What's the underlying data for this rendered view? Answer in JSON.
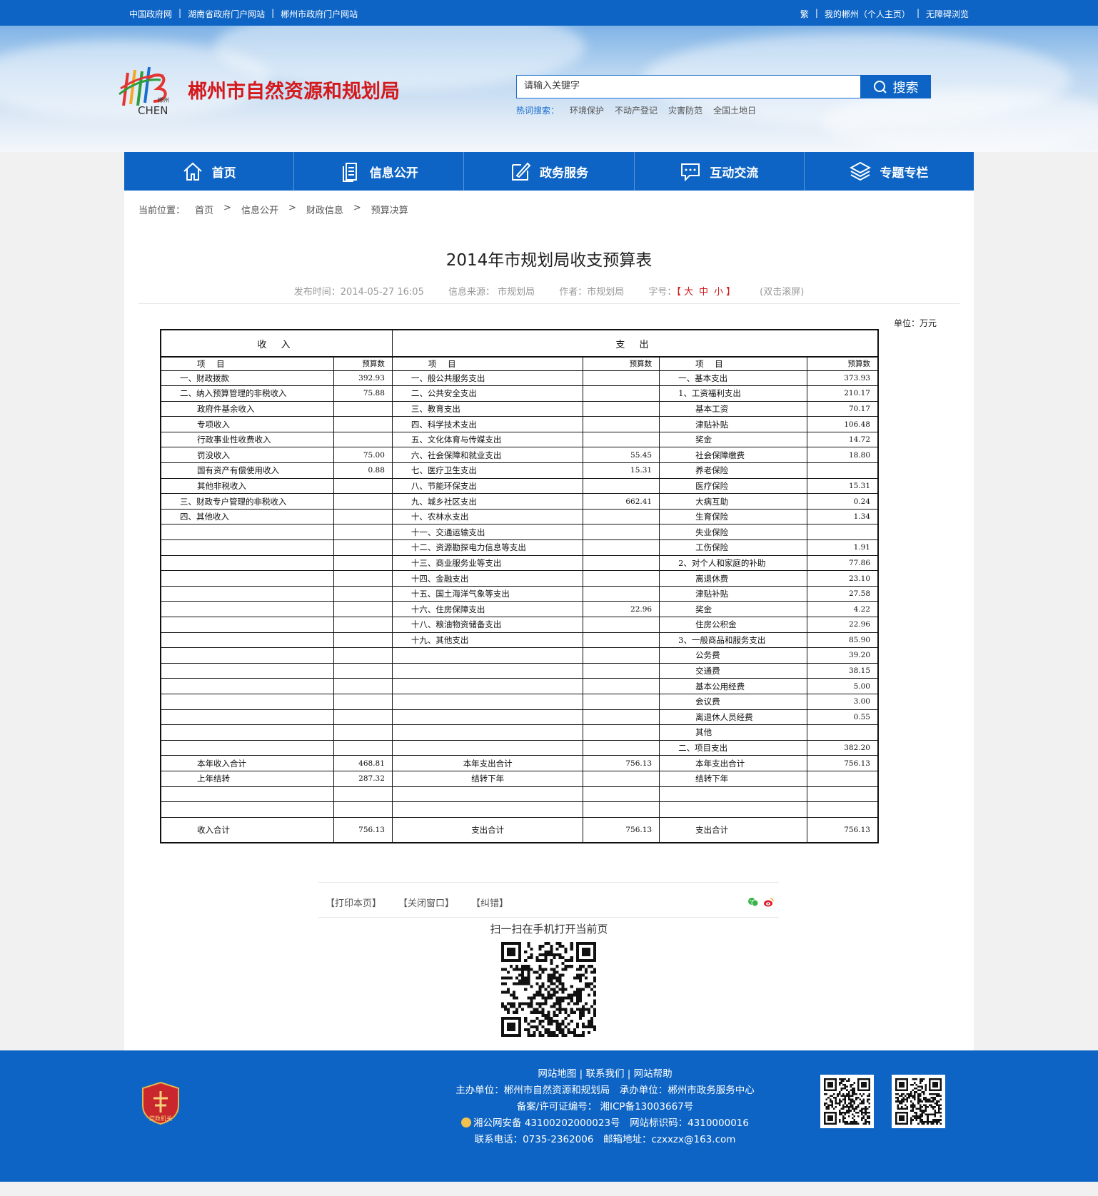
{
  "topbar": {
    "left_links": [
      "中国政府网",
      "湖南省政府门户网站",
      "郴州市政府门户网站"
    ],
    "right_links": [
      "繁",
      "我的郴州（个人主页）",
      "无障碍浏览"
    ]
  },
  "header": {
    "site_name": "郴州市自然资源和规划局",
    "logo_text": "CHEN",
    "logo_small": "郴州",
    "search_placeholder": "请输入关键字",
    "search_button": "搜索",
    "hot_label": "热词搜索：",
    "hot_words": [
      "环境保护",
      "不动产登记",
      "灾害防范",
      "全国土地日"
    ]
  },
  "nav": {
    "items": [
      {
        "label": "首页",
        "icon": "home-icon"
      },
      {
        "label": "信息公开",
        "icon": "document-icon"
      },
      {
        "label": "政务服务",
        "icon": "edit-icon"
      },
      {
        "label": "互动交流",
        "icon": "chat-icon"
      },
      {
        "label": "专题专栏",
        "icon": "layers-icon"
      }
    ]
  },
  "breadcrumb": {
    "label": "当前位置：",
    "items": [
      "首页",
      ">",
      "信息公开",
      ">",
      "财政信息",
      ">",
      "预算决算"
    ]
  },
  "article": {
    "title": "2014年市规划局收支预算表",
    "publish": "发布时间：2014-05-27 16:05",
    "source": "信息来源： 市规划局",
    "author": "作者：市规划局",
    "font_label": "字号：",
    "font_open": "【",
    "font_big": "大",
    "font_mid": "中",
    "font_small": "小",
    "font_close": "】",
    "dblclick": "(双击滚屏)",
    "unit": "单位：万元"
  },
  "table": {
    "header_income": "收 入",
    "header_expense": "支 出",
    "subheaders": [
      "项 目",
      "预算数",
      "项 目",
      "预算数",
      "项 目",
      "预算数"
    ],
    "rows": [
      [
        "一、财政拨款",
        "392.93",
        "一、般公共服务支出",
        "",
        "一、基本支出",
        "373.93"
      ],
      [
        "二、纳入预算管理的非税收入",
        "75.88",
        "二、公共安全支出",
        "",
        "1、工资福利支出",
        "210.17"
      ],
      [
        "政府件基余收入",
        "",
        "三、教育支出",
        "",
        "基本工资",
        "70.17"
      ],
      [
        "专项收入",
        "",
        "四、科学技术支出",
        "",
        "津贴补贴",
        "106.48"
      ],
      [
        "行政事业性收费收入",
        "",
        "五、文化体育与传媒支出",
        "",
        "奖金",
        "14.72"
      ],
      [
        "罚没收入",
        "75.00",
        "六、社会保障和就业支出",
        "55.45",
        "社会保障缴费",
        "18.80"
      ],
      [
        "国有资产有偿使用收入",
        "0.88",
        "七、医疗卫生支出",
        "15.31",
        "养老保险",
        ""
      ],
      [
        "其他非税收入",
        "",
        "八、节能环保支出",
        "",
        "医疗保险",
        "15.31"
      ],
      [
        "三、财政专户管理的非税收入",
        "",
        "九、城乡社区支出",
        "662.41",
        "大病互助",
        "0.24"
      ],
      [
        "四、其他收入",
        "",
        "十、农林水支出",
        "",
        "生育保险",
        "1.34"
      ],
      [
        "",
        "",
        "十一、交通运输支出",
        "",
        "失业保险",
        ""
      ],
      [
        "",
        "",
        "十二、资源勘探电力信息等支出",
        "",
        "工伤保险",
        "1.91"
      ],
      [
        "",
        "",
        "十三、商业服务业等支出",
        "",
        "2、对个人和家庭的补助",
        "77.86"
      ],
      [
        "",
        "",
        "十四、金融支出",
        "",
        "离退休费",
        "23.10"
      ],
      [
        "",
        "",
        "十五、国土海洋气象等支出",
        "",
        "津贴补贴",
        "27.58"
      ],
      [
        "",
        "",
        "十六、住房保障支出",
        "22.96",
        "奖金",
        "4.22"
      ],
      [
        "",
        "",
        "十八、粮油物资储备支出",
        "",
        "住房公积金",
        "22.96"
      ],
      [
        "",
        "",
        "十九、其他支出",
        "",
        "3、一般商品和服务支出",
        "85.90"
      ],
      [
        "",
        "",
        "",
        "",
        "公务费",
        "39.20"
      ],
      [
        "",
        "",
        "",
        "",
        "交通费",
        "38.15"
      ],
      [
        "",
        "",
        "",
        "",
        "基本公用经费",
        "5.00"
      ],
      [
        "",
        "",
        "",
        "",
        "会议费",
        "3.00"
      ],
      [
        "",
        "",
        "",
        "",
        "离退休人员经费",
        "0.55"
      ],
      [
        "",
        "",
        "",
        "",
        "其他",
        ""
      ],
      [
        "",
        "",
        "",
        "",
        "二、项目支出",
        "382.20"
      ],
      [
        "本年收入合计",
        "468.81",
        "本年支出合计",
        "756.13",
        "本年支出合计",
        "756.13"
      ],
      [
        "上年结转",
        "287.32",
        "结转下年",
        "",
        "结转下年",
        ""
      ],
      [
        "",
        "",
        "",
        "",
        "",
        ""
      ],
      [
        "",
        "",
        "",
        "",
        "",
        ""
      ],
      [
        "收入合计",
        "756.13",
        "支出合计",
        "756.13",
        "支出合计",
        "756.13"
      ]
    ]
  },
  "tools": {
    "print": "【打印本页】",
    "close": "【关闭窗口】",
    "error": "【纠错】",
    "scan": "扫一扫在手机打开当前页"
  },
  "footer": {
    "links": "网站地图 | 联系我们 | 网站帮助",
    "host": "主办单位：郴州市自然资源和规划局　承办单位：郴州市政务服务中心",
    "icp": "备案/许可证编号： 湘ICP备13003667号",
    "police": "湘公网安备 43100202000023号　网站标识码：4310000016",
    "contact": "联系电话：0735-2362006　邮箱地址：czxxzx@163.com",
    "emblem_text": "党政机关"
  },
  "colors": {
    "primary": "#0d64c4",
    "title_red": "#d4191c"
  }
}
